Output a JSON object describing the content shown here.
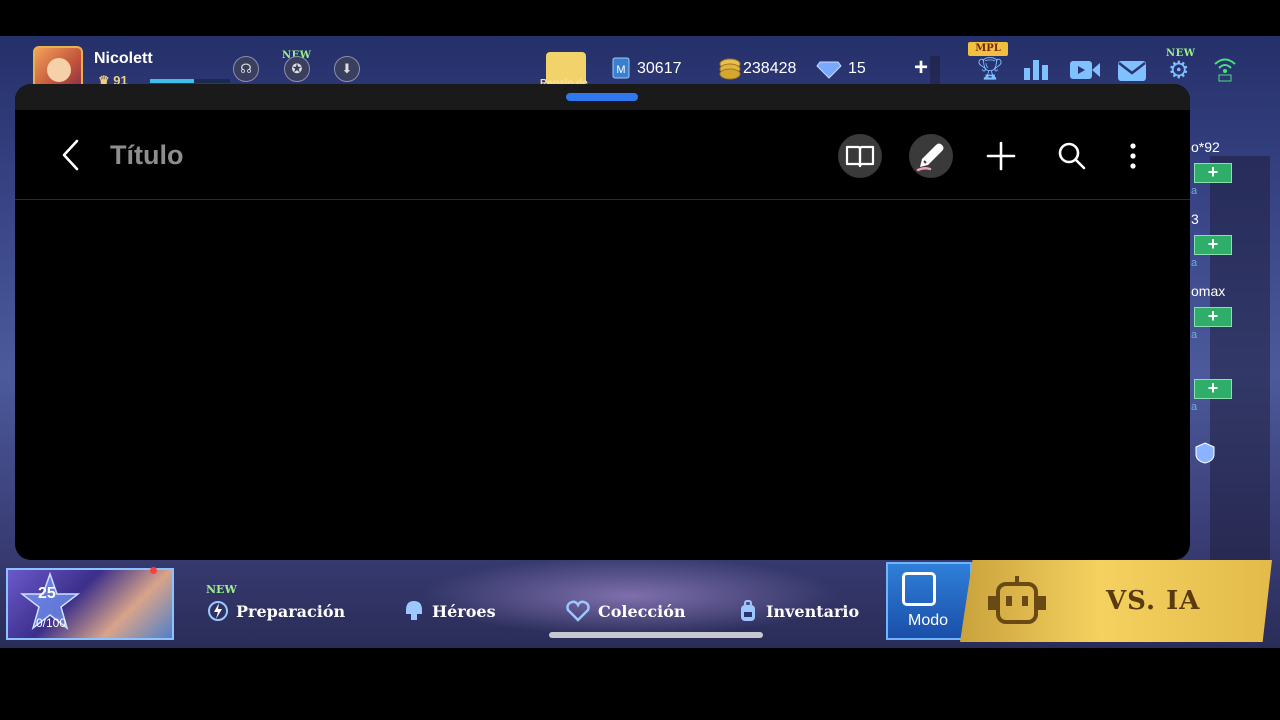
{
  "game": {
    "player": {
      "name": "Nicolett",
      "level": "91",
      "xp_fraction": 0.55
    },
    "new_badge": "NEW",
    "gift_label": "Regalo de",
    "currencies": [
      {
        "icon": "ticket-icon",
        "value": "30617"
      },
      {
        "icon": "gold-coin-icon",
        "value": "238428"
      },
      {
        "icon": "diamond-icon",
        "value": "15"
      }
    ],
    "mpl_badge": "MPL",
    "right_panel": {
      "entries": [
        {
          "name": "o*92",
          "sub": "a"
        },
        {
          "name": "3",
          "sub": "a"
        },
        {
          "name": "omax",
          "sub": "a"
        },
        {
          "name": "",
          "sub": "a"
        }
      ],
      "plus_label": "+"
    },
    "hero_card": {
      "level": "25",
      "progress": "0/100"
    },
    "nav": {
      "new_badge": "NEW",
      "items": [
        {
          "label": "Preparación",
          "icon": "bolt-icon"
        },
        {
          "label": "Héroes",
          "icon": "helmet-icon"
        },
        {
          "label": "Colección",
          "icon": "heart-icon"
        },
        {
          "label": "Inventario",
          "icon": "backpack-icon"
        }
      ],
      "mode_label": "Modo",
      "play_label": "VS. IA"
    }
  },
  "sheet": {
    "title": "Título",
    "actions": [
      {
        "name": "reader-mode-button",
        "icon": "book-icon"
      },
      {
        "name": "edit-button",
        "icon": "pencil-icon"
      },
      {
        "name": "add-button",
        "icon": "plus-icon"
      },
      {
        "name": "search-button",
        "icon": "search-icon"
      },
      {
        "name": "more-options-button",
        "icon": "more-vertical-icon"
      }
    ],
    "colors": {
      "handle": "#2f78f0",
      "title": "#8e8e8e",
      "background": "#000000"
    }
  }
}
